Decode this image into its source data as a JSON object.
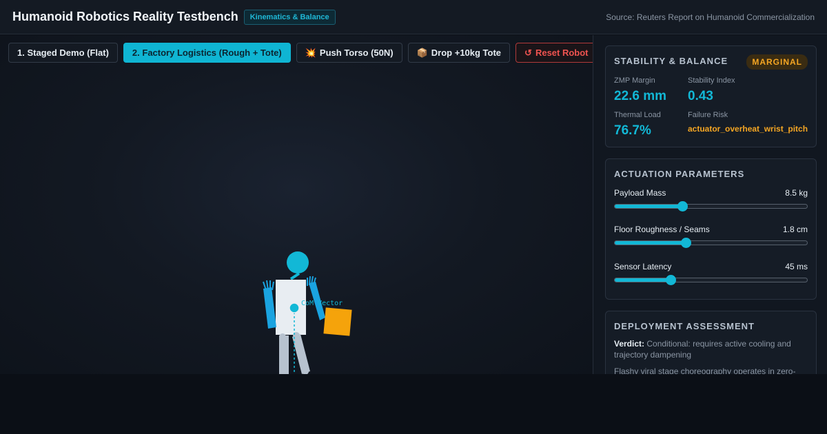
{
  "header": {
    "title": "Humanoid Robotics Reality Testbench",
    "badge": "Kinematics & Balance",
    "source": "Source: Reuters Report on Humanoid Commercialization"
  },
  "toolbar": {
    "staged_demo": "1. Staged Demo (Flat)",
    "factory_logistics": "2. Factory Logistics (Rough + Tote)",
    "push_torso": "Push Torso (50N)",
    "drop_tote": "Drop +10kg Tote",
    "reset_robot": "Reset Robot",
    "push_icon": "💥",
    "drop_icon": "📦",
    "reset_icon": "↺"
  },
  "scene": {
    "com_label": "CoM Vector"
  },
  "stability": {
    "title": "Stability & Balance",
    "status": "MARGINAL",
    "zmp_label": "ZMP Margin",
    "zmp_value": "22.6 mm",
    "index_label": "Stability Index",
    "index_value": "0.43",
    "thermal_label": "Thermal Load",
    "thermal_value": "76.7%",
    "risk_label": "Failure Risk",
    "risk_value": "actuator_overheat_wrist_pitch"
  },
  "actuation": {
    "title": "Actuation Parameters",
    "sliders": [
      {
        "label": "Payload Mass",
        "value": "8.5 kg",
        "level": 0.35
      },
      {
        "label": "Floor Roughness / Seams",
        "value": "1.8 cm",
        "level": 0.37
      },
      {
        "label": "Sensor Latency",
        "value": "45 ms",
        "level": 0.29
      }
    ]
  },
  "deployment": {
    "title": "Deployment Assessment",
    "verdict_label": "Verdict:",
    "verdict_text": "Conditional: requires active cooling and trajectory dampening",
    "note": "Flashy viral stage choreography operates in zero-"
  },
  "colors": {
    "accent": "#12b8d6",
    "warning": "#f5a623",
    "danger": "#ef5350",
    "tote": "#f5a30b"
  }
}
